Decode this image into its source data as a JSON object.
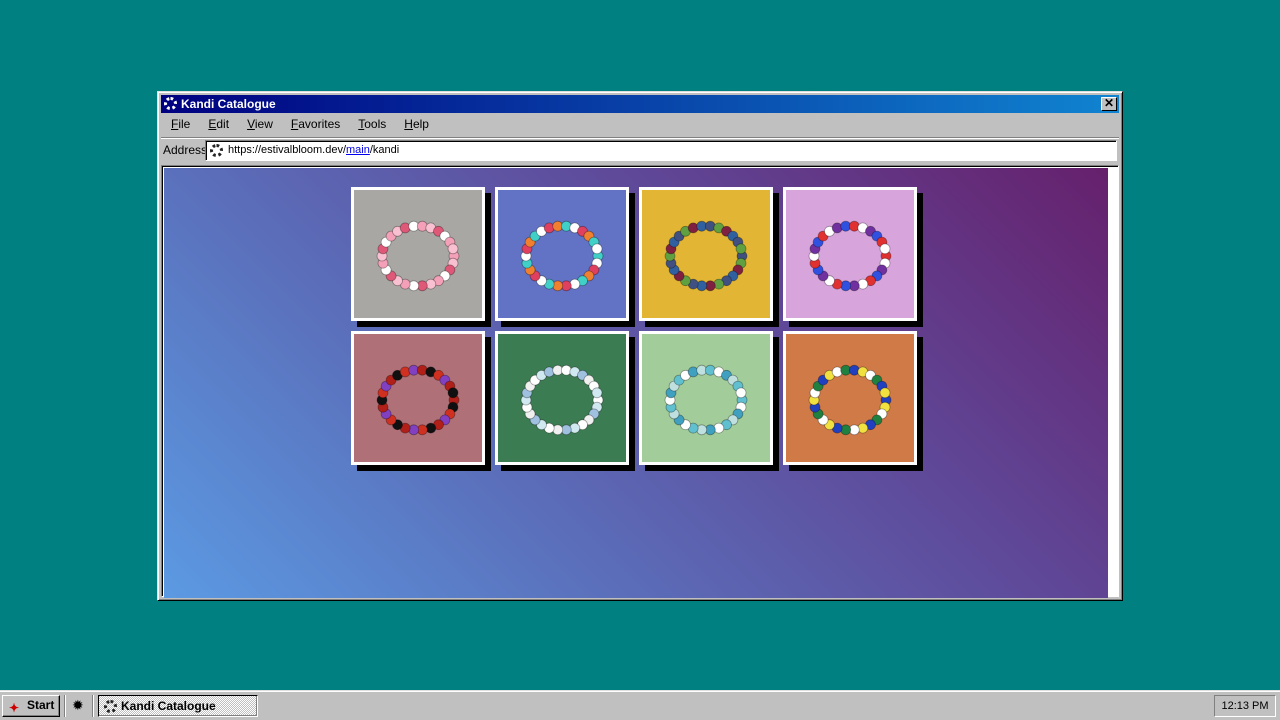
{
  "window": {
    "title": "Kandi Catalogue",
    "close_label": "✕"
  },
  "menu": {
    "items": [
      "File",
      "Edit",
      "View",
      "Favorites",
      "Tools",
      "Help"
    ]
  },
  "address": {
    "label": "Address",
    "url_prefix": "https://estivalbloom.dev/",
    "url_link": "main",
    "url_suffix": "/kandi"
  },
  "gallery": {
    "tiles": [
      {
        "bg": "#a8a7a4",
        "beads": [
          "#f3a0b8",
          "#f8c0d0",
          "#e05878",
          "#ffffff"
        ]
      },
      {
        "bg": "#6272c4",
        "beads": [
          "#40d0c8",
          "#ffffff",
          "#e04060",
          "#f08030"
        ]
      },
      {
        "bg": "#e2b634",
        "beads": [
          "#405080",
          "#60a040",
          "#802040",
          "#3060a0"
        ]
      },
      {
        "bg": "#d8a4dc",
        "beads": [
          "#e03030",
          "#ffffff",
          "#7030a0",
          "#3050e0"
        ]
      },
      {
        "bg": "#b07078",
        "beads": [
          "#b02018",
          "#101010",
          "#d03020",
          "#8040c0"
        ]
      },
      {
        "bg": "#3c7c52",
        "beads": [
          "#ffffff",
          "#d0e8f0",
          "#a0c0e0",
          "#f0f0f0"
        ]
      },
      {
        "bg": "#a2cc9a",
        "beads": [
          "#60c0d0",
          "#ffffff",
          "#40a0c0",
          "#c0e0e0"
        ]
      },
      {
        "bg": "#d07a48",
        "beads": [
          "#2040c0",
          "#f0e040",
          "#ffffff",
          "#208040"
        ]
      }
    ]
  },
  "taskbar": {
    "start_label": "Start",
    "task_label": "Kandi Catalogue",
    "clock": "12:13 PM"
  }
}
